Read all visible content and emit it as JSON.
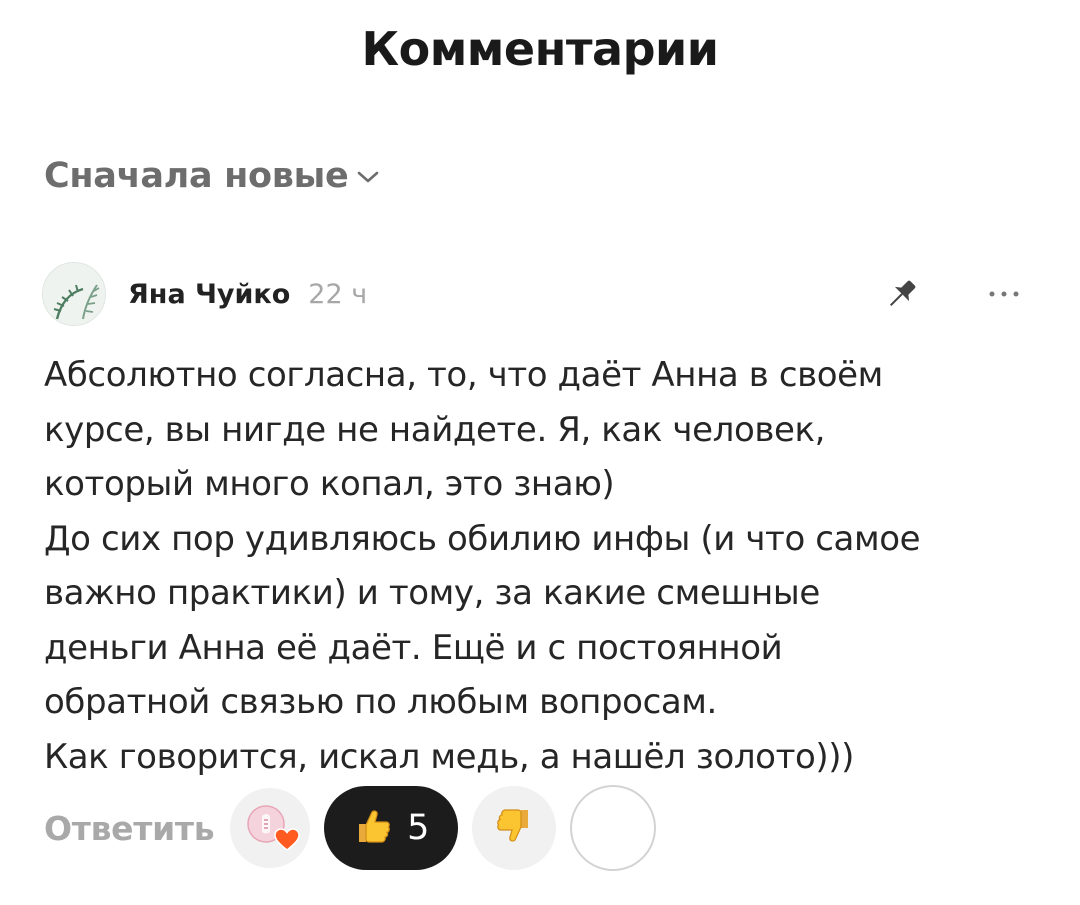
{
  "header": {
    "title": "Комментарии"
  },
  "sort": {
    "label": "Сначала новые"
  },
  "comment": {
    "author": "Яна Чуйко",
    "time": "22 ч",
    "lines": [
      "Абсолютно согласна, то, что даёт Анна в своём",
      "курсе, вы нигде не найдете. Я, как человек,",
      "который много копал, это знаю)",
      "До сих пор удивляюсь обилию инфы (и что самое",
      "важно практики) и тому, за какие смешные",
      "деньги Анна её даёт. Ещё и с постоянной",
      "обратной связью по любым вопросам.",
      "Как говорится, искал медь, а нашёл золото)))"
    ],
    "actions": {
      "reply_label": "Ответить",
      "like_count": "5"
    }
  },
  "icons": {
    "sort": "chevron-down-icon",
    "pin": "pin-icon",
    "more": "more-dots-icon",
    "like": "thumbs-up-icon",
    "dislike": "thumbs-down-icon",
    "reaction": "heart-reaction-icon"
  },
  "colors": {
    "like_button_bg": "#1c1c1c",
    "reaction_bg": "#f1f1f1",
    "muted_text": "#a9a9a9",
    "heart": "#ff5a1f"
  }
}
